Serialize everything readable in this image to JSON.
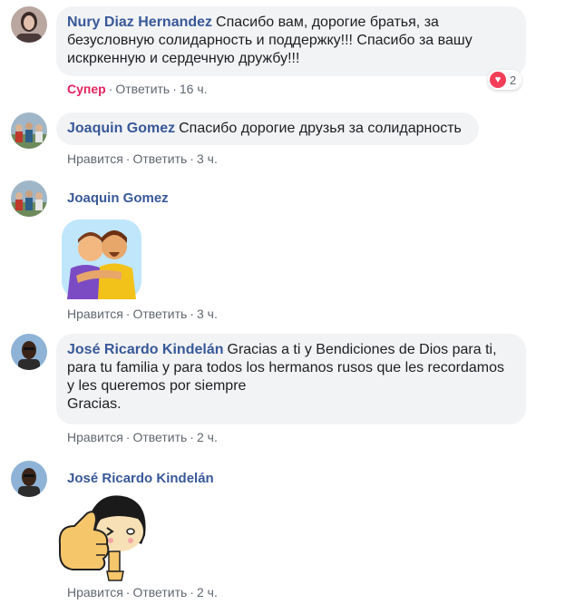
{
  "comments": [
    {
      "author": "Nury Diaz Hernandez",
      "text": "Спасибо вам, дорогие братья, за безусловную солидарность и поддержку!!! Спасибо за вашу искркенную и сердечную дружбу!!!",
      "reaction_label": "Супер",
      "reply_label": "Ответить",
      "time": "16 ч.",
      "reaction_count": "2",
      "reaction_icon": "heart-icon"
    },
    {
      "author": "Joaquin Gomez",
      "text": "Спасибо дорогие друзья за солидарность",
      "like_label": "Нравится",
      "reply_label": "Ответить",
      "time": "3 ч."
    },
    {
      "author": "Joaquin Gomez",
      "sticker": "hug-sticker",
      "like_label": "Нравится",
      "reply_label": "Ответить",
      "time": "3 ч."
    },
    {
      "author": "José Ricardo Kindelán",
      "text": "Gracias a ti y Bendiciones de Dios para ti, para tu familia y para todos los hermanos rusos que les recordamos y les queremos por siempre",
      "text2": "Gracias.",
      "like_label": "Нравится",
      "reply_label": "Ответить",
      "time": "2 ч."
    },
    {
      "author": "José Ricardo Kindelán",
      "sticker": "thumbs-up-girl-sticker",
      "like_label": "Нравится",
      "reply_label": "Ответить",
      "time": "2 ч."
    }
  ],
  "separator": "·",
  "colors": {
    "author": "#385898",
    "super": "#e0245e",
    "bubble": "#f2f3f5",
    "meta": "#606770"
  }
}
